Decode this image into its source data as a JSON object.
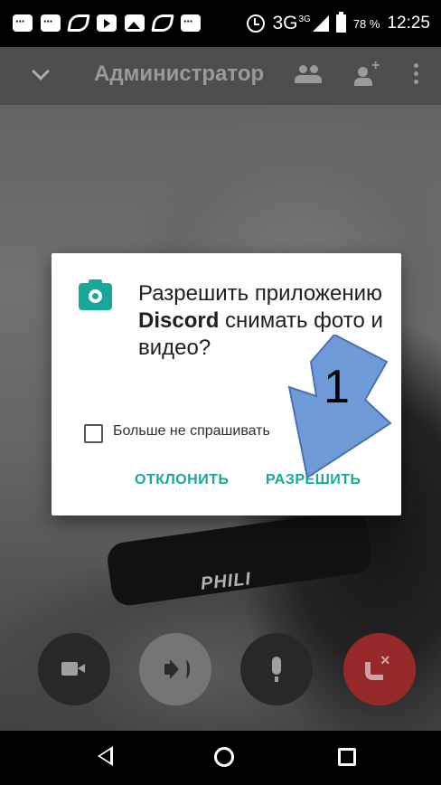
{
  "status_bar": {
    "network": "3G",
    "network_sup": "3G",
    "battery": "78 %",
    "time": "12:25"
  },
  "toolbar": {
    "title": "Администратор"
  },
  "background": {
    "watermark": "PHILI"
  },
  "dialog": {
    "message_pre": "Разрешить приложению ",
    "app_name": "Discord",
    "message_post": " снимать фото и видео?",
    "checkbox_label": "Больше не спрашивать",
    "checkbox_checked": false,
    "deny_label": "ОТКЛОНИТЬ",
    "allow_label": "РАЗРЕШИТЬ"
  },
  "annotation": {
    "label": "1",
    "color": "#6f9ad8"
  },
  "colors": {
    "accent": "#18a89a",
    "hangup": "#b13030"
  }
}
